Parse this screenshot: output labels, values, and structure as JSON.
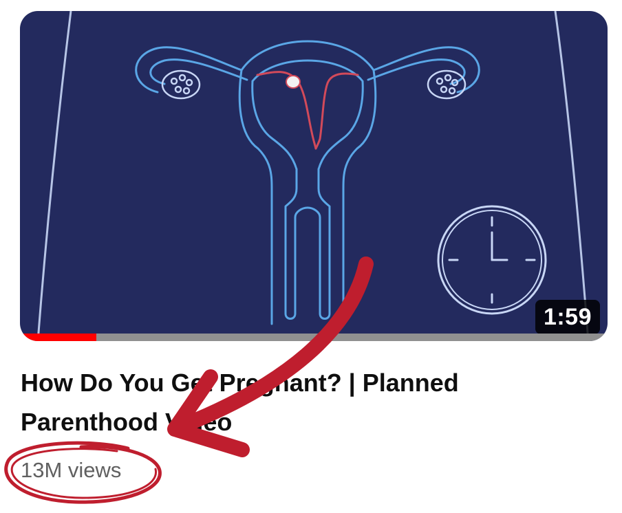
{
  "video": {
    "duration": "1:59",
    "watch_progress": 0.13,
    "title": "How Do You Get Pregnant? | Planned Parenthood Video",
    "views": "13M views"
  },
  "colors": {
    "thumbnail_bg": "#232a5e",
    "diagram_line": "#5aa6e6",
    "fallopian_red": "#d24a5a",
    "progress_red": "#ff0000",
    "annotation_red": "#bf1e2e"
  },
  "thumbnail_icons": [
    "uterus-diagram-icon",
    "clock-icon"
  ]
}
